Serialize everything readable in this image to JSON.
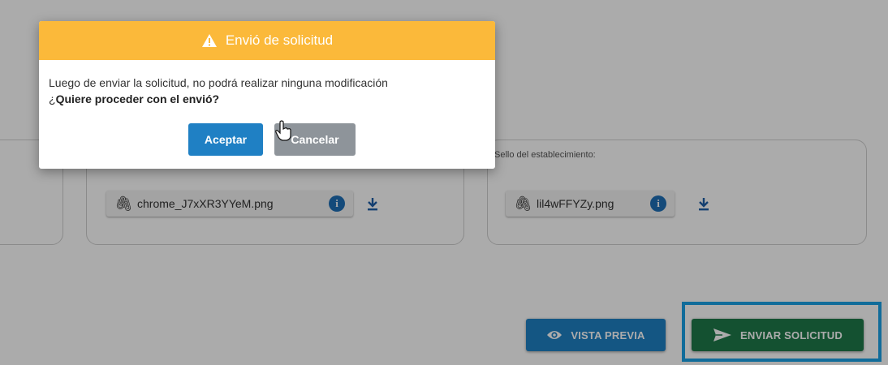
{
  "form": {
    "left_card": {},
    "middle_card": {
      "file_name": "chrome_J7xXR3YYeM.png",
      "info_icon": "info-icon",
      "download_icon": "download-icon"
    },
    "right_card": {
      "label": "Sello del establecimiento:",
      "file_name": "lil4wFFYZy.png",
      "info_icon": "info-icon",
      "download_icon": "download-icon"
    }
  },
  "actions": {
    "preview_label": "VISTA PREVIA",
    "preview_icon": "eye-icon",
    "send_label": "ENVIAR SOLICITUD",
    "send_icon": "send-icon",
    "highlight_color": "#1aa2e6"
  },
  "dialog": {
    "title": "Envió de solicitud",
    "title_icon": "warning-icon",
    "message": "Luego de enviar la solicitud, no podrá realizar ninguna modificación",
    "question_prefix": "¿",
    "question": "Quiere proceder con el envió?",
    "accept_label": "Aceptar",
    "cancel_label": "Cancelar",
    "header_color": "#fbb93a"
  },
  "colors": {
    "primary": "#1f80c4",
    "success": "#1e7a4a",
    "muted": "#8e949a"
  }
}
